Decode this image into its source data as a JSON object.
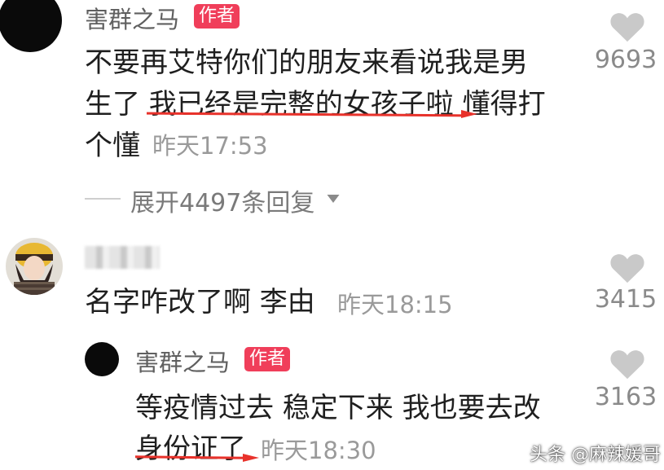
{
  "comments": [
    {
      "username": "害群之马",
      "badge": "作者",
      "text_lines": [
        "不要再艾特你们的朋友来看说我是男",
        "生了 我已经是完整的女孩子啦 懂得打",
        "个懂"
      ],
      "time": "昨天17:53",
      "likes": "9693",
      "expand_label": "展开4497条回复"
    },
    {
      "username": "",
      "text": "名字咋改了啊 李由",
      "time": "昨天18:15",
      "likes": "3415"
    }
  ],
  "reply": {
    "username": "害群之马",
    "badge": "作者",
    "text_lines": [
      "等疫情过去 稳定下来 我也要去改",
      "身份证了"
    ],
    "time": "昨天18:30",
    "likes": "3163"
  },
  "watermark": "头条 @麻辣媛哥",
  "colors": {
    "badge": "#f03e5a",
    "underline": "#e8322b",
    "time": "#9a9a9a"
  },
  "icons": [
    "heart-icon",
    "chevron-down-icon"
  ]
}
